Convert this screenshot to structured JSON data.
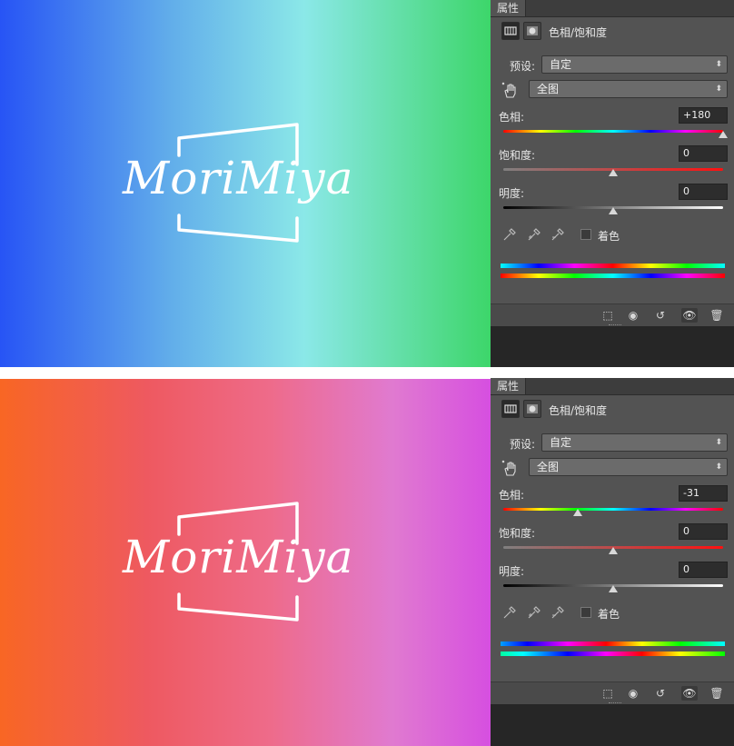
{
  "artwork": {
    "logo_text": "MoriMiya"
  },
  "panels": [
    {
      "tab_label": "属性",
      "menu_icon": "panel-menu-icon",
      "title": "色相/饱和度",
      "preset_label": "预设:",
      "preset_value": "自定",
      "channel_value": "全图",
      "hue_label": "色相:",
      "hue_value": "+180",
      "hue_level": 1.0,
      "saturation_label": "饱和度:",
      "saturation_value": "0",
      "saturation_level": 0.5,
      "lightness_label": "明度:",
      "lightness_value": "0",
      "lightness_level": 0.5,
      "colorize_label": "着色",
      "colorize_checked": false,
      "canvas_gradient": [
        "#2754f5",
        "#8be8e8",
        "#3dd66a"
      ]
    },
    {
      "tab_label": "属性",
      "menu_icon": "panel-menu-icon",
      "title": "色相/饱和度",
      "preset_label": "预设:",
      "preset_value": "自定",
      "channel_value": "全图",
      "hue_label": "色相:",
      "hue_value": "-31",
      "hue_level": 0.34,
      "saturation_label": "饱和度:",
      "saturation_value": "0",
      "saturation_level": 0.5,
      "lightness_label": "明度:",
      "lightness_value": "0",
      "lightness_level": 0.5,
      "colorize_label": "着色",
      "colorize_checked": false,
      "canvas_gradient": [
        "#f86624",
        "#ee6b8a",
        "#d64fe0"
      ]
    }
  ],
  "colors": {
    "panel_bg": "#535353",
    "tab_bar_bg": "#3d3d3d",
    "value_box_bg": "#2d2d2d",
    "dropdown_bg": "#6b6b6b"
  }
}
